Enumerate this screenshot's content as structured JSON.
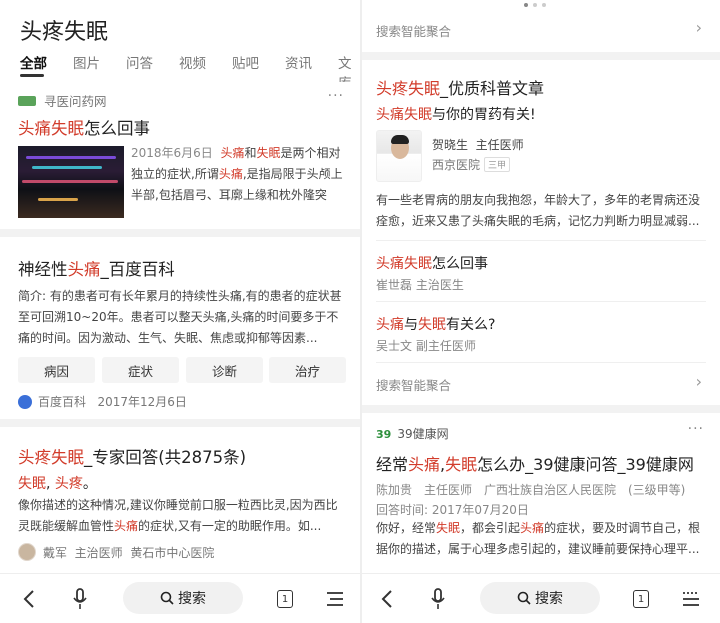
{
  "left": {
    "query": "头疼失眠",
    "tabs": [
      "全部",
      "图片",
      "问答",
      "视频",
      "贴吧",
      "资讯",
      "文库"
    ],
    "result1": {
      "source": "寻医问药网",
      "title_hl": "头痛失眠",
      "title_rest": "怎么回事",
      "date": "2018年6月6日",
      "text_a": "头痛",
      "text_b": "和",
      "text_c": "失眠",
      "text_d": "是两个相对独立的症状,所谓",
      "text_e": "头痛",
      "text_f": ",是指局限于头颅上半部,包括眉弓、耳廓上缘和枕外隆突连..."
    },
    "result2": {
      "title_a": "神经性",
      "title_hl": "头痛",
      "title_rest": "_百度百科",
      "text": "简介: 有的患者可有长年累月的持续性头痛,有的患者的症状甚至可回溯10~20年。患者可以整天头痛,头痛的时间要多于不痛的时间。因为激动、生气、失眠、焦虑或抑郁等因素...",
      "chips": [
        "病因",
        "症状",
        "诊断",
        "治疗"
      ],
      "source": "百度百科",
      "date": "2017年12月6日"
    },
    "result3": {
      "title_hl": "头疼失眠",
      "title_rest": "_专家回答(共2875条)",
      "sub_hl_a": "失眠",
      "sub_sep": ", ",
      "sub_hl_b": "头疼",
      "sub_end": "。",
      "text_a": "像你描述的这种情况,建议你睡觉前口服一粒西比灵,因为西比灵既能缓解血管性",
      "text_hl": "头痛",
      "text_b": "的症状,又有一定的助眠作用。如...",
      "doctor": "戴军",
      "title": "主治医师",
      "hospital": "黄石市中心医院"
    },
    "toolbar": {
      "search": "搜索",
      "page": "1"
    }
  },
  "right": {
    "aggregate_top": "搜索智能聚合",
    "article": {
      "title_hl": "头疼失眠",
      "title_rest": "_优质科普文章",
      "sub_hl": "头痛失眠",
      "sub_rest": "与你的胃药有关!",
      "doctor": "贺晓生",
      "doctor_title": "主任医师",
      "hospital": "西京医院",
      "level": "三甲",
      "text": "有一些老胃病的朋友向我抱怨，年龄大了，多年的老胃病还没痊愈，近来又患了头痛失眠的毛病，记忆力判断力明显减弱..."
    },
    "qa1": {
      "title_hl": "头痛失眠",
      "title_rest": "怎么回事",
      "doctor": "崔世磊 主治医生"
    },
    "qa2": {
      "hl_a": "头痛",
      "mid": "与",
      "hl_b": "失眠",
      "rest": "有关么?",
      "doctor": "吴士文 副主任医师"
    },
    "aggregate_bottom": "搜索智能聚合",
    "result": {
      "source": "39健康网",
      "title_a": "经常",
      "title_hl_a": "头痛",
      "title_sep": ",",
      "title_hl_b": "失眠",
      "title_rest": "怎么办_39健康问答_39健康网",
      "meta1": "陈加贵　主任医师　广西壮族自治区人民医院　(三级甲等)",
      "meta2": "回答时间: 2017年07月20日",
      "text_a": "你好，经常",
      "text_hl_a": "失眠",
      "text_b": "，都会引起",
      "text_hl_b": "头痛",
      "text_c": "的症状，要及时调节自己，根据你的描述，属于心理多虑引起的，建议睡前要保持心理平..."
    },
    "toolbar": {
      "search": "搜索",
      "page": "1"
    }
  },
  "colors": {
    "highlight": "#d23c2b",
    "chip_bg": "#f4f4f4",
    "separator": "#f2f2f2"
  }
}
